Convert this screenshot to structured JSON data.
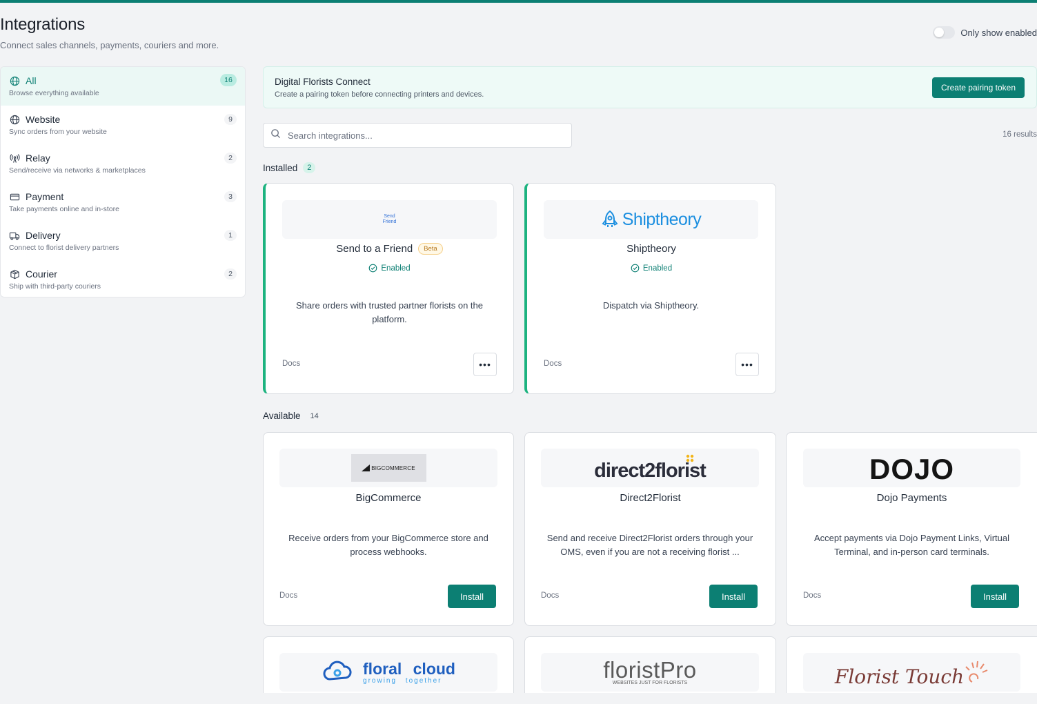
{
  "header": {
    "title": "Integrations",
    "subtitle": "Connect sales channels, payments, couriers and more.",
    "toggle_label": "Only show enabled"
  },
  "sidebar": {
    "items": [
      {
        "label": "All",
        "desc": "Browse everything available",
        "count": "16",
        "icon": "globe-icon"
      },
      {
        "label": "Website",
        "desc": "Sync orders from your website",
        "count": "9",
        "icon": "globe-icon"
      },
      {
        "label": "Relay",
        "desc": "Send/receive via networks & marketplaces",
        "count": "2",
        "icon": "antenna-icon"
      },
      {
        "label": "Payment",
        "desc": "Take payments online and in-store",
        "count": "3",
        "icon": "credit-card-icon"
      },
      {
        "label": "Delivery",
        "desc": "Connect to florist delivery partners",
        "count": "1",
        "icon": "truck-icon"
      },
      {
        "label": "Courier",
        "desc": "Ship with third-party couriers",
        "count": "2",
        "icon": "package-icon"
      }
    ]
  },
  "banner": {
    "title": "Digital Florists Connect",
    "desc": "Create a pairing token before connecting printers and devices.",
    "button": "Create pairing token"
  },
  "search": {
    "placeholder": "Search integrations...",
    "results": "16 results"
  },
  "installed": {
    "title": "Installed",
    "count": "2",
    "cards": [
      {
        "name": "Send to a Friend",
        "badge": "Beta",
        "status": "Enabled",
        "desc": "Share orders with trusted partner florists on the platform.",
        "docs": "Docs",
        "logo_text": "Send Friend"
      },
      {
        "name": "Shiptheory",
        "status": "Enabled",
        "desc": "Dispatch via Shiptheory.",
        "docs": "Docs",
        "logo_text": "Shiptheory"
      }
    ]
  },
  "available": {
    "title": "Available",
    "count": "14",
    "cards": [
      {
        "name": "BigCommerce",
        "desc": "Receive orders from your BigCommerce store and process webhooks.",
        "docs": "Docs",
        "button": "Install",
        "logo_text": "BIGCOMMERCE"
      },
      {
        "name": "Direct2Florist",
        "desc": "Send and receive Direct2Florist orders through your OMS, even if you are not a receiving florist ...",
        "docs": "Docs",
        "button": "Install",
        "logo_text": "direct2florist"
      },
      {
        "name": "Dojo Payments",
        "desc": "Accept payments via Dojo Payment Links, Virtual Terminal, and in-person card terminals.",
        "docs": "Docs",
        "button": "Install",
        "logo_text": "DOJO"
      }
    ],
    "partial_logos": [
      {
        "main": "floral cloud",
        "tag": "growing together"
      },
      {
        "main": "floristPro",
        "tag": "WEBSITES JUST FOR FLORISTS"
      },
      {
        "main": "Florist Touch"
      }
    ]
  },
  "colors": {
    "accent": "#0c7f73",
    "installed_border": "#1cb37f",
    "background": "#f2f3f5"
  }
}
